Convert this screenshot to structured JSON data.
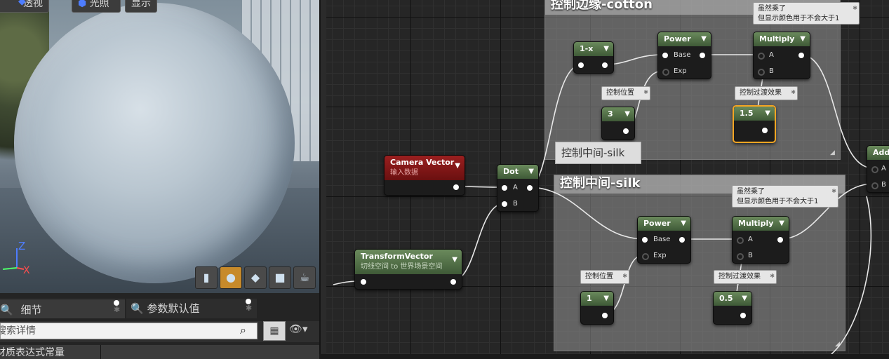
{
  "viewport": {
    "btn_perspective": "透视",
    "btn_lit": "光照",
    "btn_show": "显示",
    "gizmo_z": "Z",
    "gizmo_x": "X",
    "tools": [
      "cylinder-icon",
      "sphere-icon",
      "plane-icon",
      "cube-icon",
      "teapot-icon"
    ]
  },
  "details": {
    "tab_details": "细节",
    "tab_params": "参数默认值",
    "search_placeholder": "搜索详情",
    "section_header": "材质表达式常量"
  },
  "graph": {
    "comment_cotton": "控制边缘-cotton",
    "comment_silk": "控制中间-silk",
    "tooltip_silk": "控制中间-silk",
    "nodes": {
      "camera_vector": {
        "title": "Camera Vector",
        "subtitle": "输入数据"
      },
      "transform_vector": {
        "title": "TransformVector",
        "subtitle": "切线空间 to 世界场景空间"
      },
      "dot": {
        "title": "Dot",
        "pin_a": "A",
        "pin_b": "B"
      },
      "one_minus_x": {
        "title": "1-x"
      },
      "power_top": {
        "title": "Power",
        "pin_base": "Base",
        "pin_exp": "Exp"
      },
      "multiply_top": {
        "title": "Multiply",
        "pin_a": "A",
        "pin_b": "B"
      },
      "const_3": {
        "title": "3"
      },
      "const_1_5": {
        "title": "1.5"
      },
      "power_bottom": {
        "title": "Power",
        "pin_base": "Base",
        "pin_exp": "Exp"
      },
      "multiply_bottom": {
        "title": "Multiply",
        "pin_a": "A",
        "pin_b": "B"
      },
      "const_1": {
        "title": "1"
      },
      "const_0_5": {
        "title": "0.5"
      },
      "add": {
        "title": "Add",
        "pin_a": "A",
        "pin_b": "B"
      }
    },
    "notes": {
      "position_top": "控制位置",
      "transition_top": "控制过渡效果",
      "multiply_top_note_line1": "虽然乘了",
      "multiply_top_note_line2": "但显示颜色用于不会大于1",
      "position_bottom": "控制位置",
      "transition_bottom": "控制过渡效果",
      "multiply_bottom_note_line1": "虽然乘了",
      "multiply_bottom_note_line2": "但显示颜色用于不会大于1"
    }
  }
}
